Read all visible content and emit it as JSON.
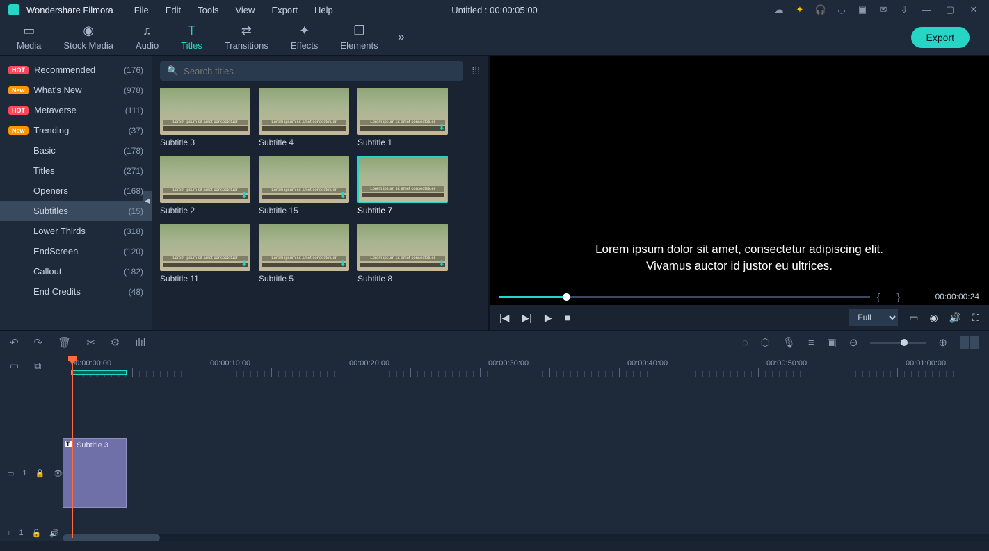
{
  "titlebar": {
    "appname": "Wondershare Filmora",
    "menu": [
      "File",
      "Edit",
      "Tools",
      "View",
      "Export",
      "Help"
    ],
    "project": "Untitled : 00:00:05:00"
  },
  "toolbar": {
    "tabs": [
      {
        "label": "Media",
        "icon": "▭"
      },
      {
        "label": "Stock Media",
        "icon": "◉"
      },
      {
        "label": "Audio",
        "icon": "♫"
      },
      {
        "label": "Titles",
        "icon": "T",
        "active": true
      },
      {
        "label": "Transitions",
        "icon": "⇄"
      },
      {
        "label": "Effects",
        "icon": "✦"
      },
      {
        "label": "Elements",
        "icon": "❐"
      }
    ],
    "export": "Export"
  },
  "sidebar": {
    "items": [
      {
        "badge": "HOT",
        "badgeClass": "hot",
        "label": "Recommended",
        "count": "(176)"
      },
      {
        "badge": "New",
        "badgeClass": "new",
        "label": "What's New",
        "count": "(978)"
      },
      {
        "badge": "HOT",
        "badgeClass": "hot",
        "label": "Metaverse",
        "count": "(111)"
      },
      {
        "badge": "New",
        "badgeClass": "new",
        "label": "Trending",
        "count": "(37)"
      },
      {
        "label": "Basic",
        "count": "(178)"
      },
      {
        "label": "Titles",
        "count": "(271)"
      },
      {
        "label": "Openers",
        "count": "(168)"
      },
      {
        "label": "Subtitles",
        "count": "(15)",
        "active": true
      },
      {
        "label": "Lower Thirds",
        "count": "(318)"
      },
      {
        "label": "EndScreen",
        "count": "(120)"
      },
      {
        "label": "Callout",
        "count": "(182)"
      },
      {
        "label": "End Credits",
        "count": "(48)"
      }
    ]
  },
  "search": {
    "placeholder": "Search titles"
  },
  "thumbs": [
    {
      "label": "Subtitle 3"
    },
    {
      "label": "Subtitle 4"
    },
    {
      "label": "Subtitle 1",
      "dl": true
    },
    {
      "label": "Subtitle 2",
      "dl": true
    },
    {
      "label": "Subtitle 15",
      "dl": true
    },
    {
      "label": "Subtitle 7",
      "selected": true
    },
    {
      "label": "Subtitle 11",
      "dl": true
    },
    {
      "label": "Subtitle 5",
      "dl": true
    },
    {
      "label": "Subtitle 8",
      "dl": true
    }
  ],
  "preview": {
    "line1": "Lorem ipsum dolor sit amet, consectetur adipiscing elit.",
    "line2": "Vivamus auctor id justor eu ultrices.",
    "time": "00:00:00:24",
    "quality": "Full"
  },
  "timeline": {
    "marks": [
      "00:00:00:00",
      "00:00:10:00",
      "00:00:20:00",
      "00:00:30:00",
      "00:00:40:00",
      "00:00:50:00",
      "00:01:00:00"
    ],
    "clip": "Subtitle 3",
    "track1": "1",
    "track2": "1"
  }
}
